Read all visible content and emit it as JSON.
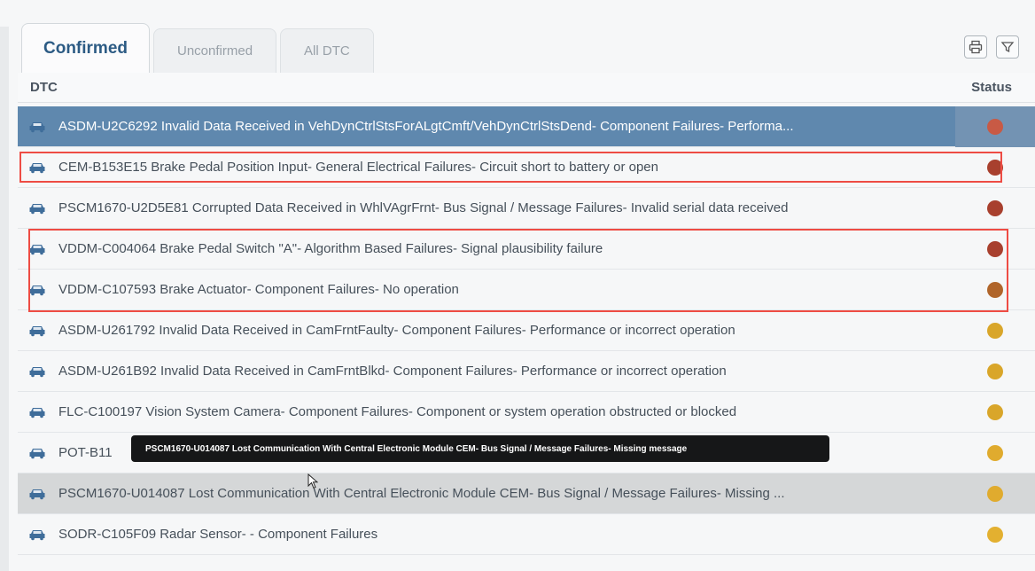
{
  "tabs": [
    {
      "label": "Confirmed",
      "active": true
    },
    {
      "label": "Unconfirmed",
      "active": false
    },
    {
      "label": "All DTC",
      "active": false
    }
  ],
  "toolbar": {
    "print_icon": "printer-icon",
    "filter_icon": "filter-icon"
  },
  "table": {
    "col_dtc": "DTC",
    "col_status": "Status",
    "rows": [
      {
        "text": "ASDM-U2C6292 Invalid Data Received in VehDynCtrlStsForALgtCmft/VehDynCtrlStsDend- Component Failures- Performa...",
        "status_color": "#c85a45",
        "selected": true
      },
      {
        "text": "CEM-B153E15 Brake Pedal Position Input- General Electrical Failures- Circuit short to battery or open",
        "status_color": "#a8402e"
      },
      {
        "text": "PSCM1670-U2D5E81 Corrupted Data Received in WhlVAgrFrnt- Bus Signal / Message Failures- Invalid serial data received",
        "status_color": "#a8402e"
      },
      {
        "text": "VDDM-C004064 Brake Pedal Switch \"A\"- Algorithm Based Failures- Signal plausibility failure",
        "status_color": "#a8402e"
      },
      {
        "text": "VDDM-C107593 Brake Actuator- Component Failures- No operation",
        "status_color": "#b0652a"
      },
      {
        "text": "ASDM-U261792 Invalid Data Received in CamFrntFaulty- Component Failures- Performance or incorrect operation",
        "status_color": "#d9a62a"
      },
      {
        "text": "ASDM-U261B92 Invalid Data Received in CamFrntBlkd- Component Failures- Performance or incorrect operation",
        "status_color": "#d9a62a"
      },
      {
        "text": "FLC-C100197 Vision System Camera- Component Failures- Component or system operation obstructed or blocked",
        "status_color": "#d9a62a"
      },
      {
        "text": "POT-B11",
        "status_color": "#e0ab2e"
      },
      {
        "text": "PSCM1670-U014087 Lost Communication With Central Electronic Module CEM- Bus Signal / Message Failures- Missing ...",
        "status_color": "#e0ab2e",
        "hover": true
      },
      {
        "text": "SODR-C105F09 Radar Sensor- - Component Failures",
        "status_color": "#e3b030"
      }
    ]
  },
  "tooltip": {
    "text": "PSCM1670-U014087 Lost Communication With Central Electronic Module CEM- Bus Signal / Message Failures- Missing message"
  },
  "colors": {
    "accent": "#2c5b84",
    "selected_row": "#5f88ae",
    "highlight_box": "#ee4c44"
  }
}
